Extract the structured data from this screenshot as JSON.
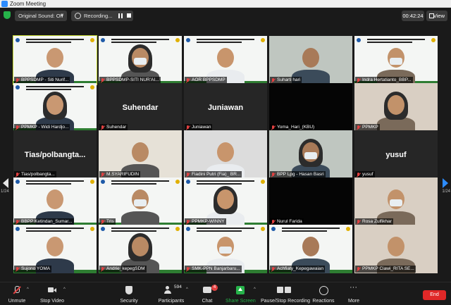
{
  "window": {
    "title": "Zoom Meeting"
  },
  "topbar": {
    "sound_label": "Original Sound: Off",
    "recording_label": "Recording...",
    "timer": "00:42:24",
    "view_label": "View"
  },
  "gallery": {
    "page_left": "1/24",
    "page_right": "1/24",
    "participants": [
      {
        "label": "BPPSDMP - Siti Nurif...",
        "kind": "slide"
      },
      {
        "label": "BPPSDMP-SITI NUR'AI...",
        "kind": "slide"
      },
      {
        "label": "AOR BPPSDMP",
        "kind": "slide"
      },
      {
        "label": "Suharti hari",
        "kind": "cam"
      },
      {
        "label": "Indra Hertatianto_BBP...",
        "kind": "slide"
      },
      {
        "label": "PPMKP - Widi Hardjo...",
        "kind": "slide"
      },
      {
        "label": "Suhendar",
        "kind": "name"
      },
      {
        "label": "Juniawan",
        "kind": "name"
      },
      {
        "label": "Yoma_Hari_(KBU)",
        "kind": "dark"
      },
      {
        "label": "PPMKP",
        "kind": "cam"
      },
      {
        "label": "Tias/polbangta...",
        "kind": "name"
      },
      {
        "label": "M.SYARIFUDIN",
        "kind": "cam"
      },
      {
        "label": "Fiadini Putri (Fia)_ BR...",
        "kind": "cam"
      },
      {
        "label": "BPP Lpg - Hasan Basri",
        "kind": "cam"
      },
      {
        "label": "yusuf",
        "kind": "name"
      },
      {
        "label": "BBPP Ketindan_Sumar...",
        "kind": "slide"
      },
      {
        "label": "Tris",
        "kind": "slide"
      },
      {
        "label": "PPMKP-WINNY",
        "kind": "slide"
      },
      {
        "label": "Nurul Farida",
        "kind": "dark"
      },
      {
        "label": "Rosa Zulfikhar",
        "kind": "cam"
      },
      {
        "label": "Sujono YOMA",
        "kind": "slide"
      },
      {
        "label": "Andrie_kepegSDM",
        "kind": "slide"
      },
      {
        "label": "SMK-PPN Banjarbaru...",
        "kind": "slide"
      },
      {
        "label": "Achfiaty_Kepegawaian",
        "kind": "slide"
      },
      {
        "label": "PPMKP Ciawi_RITA SE...",
        "kind": "cam"
      }
    ],
    "name_tiles": [
      "Suhendar",
      "Juniawan",
      "Tias/polbangta...",
      "yusuf"
    ]
  },
  "toolbar": {
    "unmute": "Unmute",
    "stop_video": "Stop Video",
    "security": "Security",
    "participants": "Participants",
    "participant_count": "594",
    "chat": "Chat",
    "chat_badge": "4",
    "share_screen": "Share Screen",
    "pause_stop_recording": "Pause/Stop Recording",
    "reactions": "Reactions",
    "more": "More",
    "end": "End"
  },
  "colors": {
    "accent_blue": "#2d8cff",
    "share_green": "#26b34a",
    "end_red": "#e02828",
    "active_speaker": "#c4d62e"
  }
}
